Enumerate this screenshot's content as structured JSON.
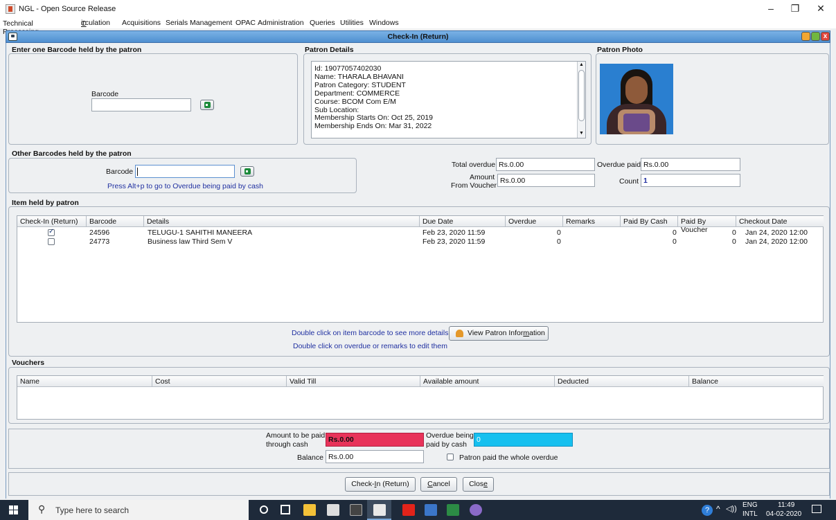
{
  "window": {
    "title": "NGL - Open Source Release",
    "min": "–",
    "max": "❐",
    "close": "✕"
  },
  "menu": [
    {
      "label": "Technical Processing",
      "mnemonic": ""
    },
    {
      "label": "Circulation",
      "mnemonic": "C"
    },
    {
      "label": "Acquisitions",
      "mnemonic": ""
    },
    {
      "label": "Serials Management",
      "mnemonic": ""
    },
    {
      "label": "OPAC",
      "mnemonic": ""
    },
    {
      "label": "Administration",
      "mnemonic": ""
    },
    {
      "label": "Queries",
      "mnemonic": ""
    },
    {
      "label": "Utilities",
      "mnemonic": ""
    },
    {
      "label": "Windows",
      "mnemonic": ""
    }
  ],
  "frame": {
    "title": "Check-In (Return)",
    "btn_colors": [
      "#f3a733",
      "#71b73f",
      "#e0453a"
    ]
  },
  "barcode_section": {
    "heading": "Enter one Barcode held by the patron",
    "label": "Barcode",
    "value": ""
  },
  "patron_details": {
    "heading": "Patron Details",
    "lines": [
      "Id: 19077057402030",
      "Name: THARALA BHAVANI",
      "Patron Category: STUDENT",
      "Department: COMMERCE",
      "Course: BCOM Com E/M",
      "Sub Location:",
      "Membership Starts On: Oct 25, 2019",
      "Membership Ends On: Mar 31, 2022"
    ]
  },
  "patron_photo": {
    "heading": "Patron Photo"
  },
  "other_barcodes": {
    "heading": "Other Barcodes held by the patron",
    "label": "Barcode",
    "value": "",
    "hint": "Press Alt+p to go to Overdue being paid by cash"
  },
  "summary": {
    "total_overdue_label": "Total overdue",
    "total_overdue": "Rs.0.00",
    "overdue_paid_label": "Overdue paid",
    "overdue_paid": "Rs.0.00",
    "amount_paid_label1": "Amount Paid",
    "amount_paid_label2": "From Voucher",
    "amount_paid": "Rs.0.00",
    "count_label": "Count",
    "count": "1"
  },
  "items": {
    "heading": "Item held by patron",
    "columns": [
      "Check-In (Return)",
      "Barcode",
      "Details",
      "Due Date",
      "Overdue",
      "Remarks",
      "Paid By Cash",
      "Paid By Voucher",
      "Checkout Date"
    ],
    "rows": [
      {
        "checked": true,
        "barcode": "24596",
        "details": "TELUGU-1 SAHITHI MANEERA",
        "due": "Feb 23, 2020 11:59",
        "overdue": "0",
        "remarks": "",
        "cash": "0",
        "voucher": "0",
        "checkout": "Jan 24, 2020 12:00"
      },
      {
        "checked": false,
        "barcode": "24773",
        "details": "Business law Third  Sem V",
        "due": "Feb 23, 2020 11:59",
        "overdue": "0",
        "remarks": "",
        "cash": "0",
        "voucher": "0",
        "checkout": "Jan 24, 2020 12:00"
      }
    ],
    "hint1": "Double click on item barcode to see more details",
    "hint2": "Double click on overdue or remarks to edit them",
    "view_btn": "View Patron Information"
  },
  "vouchers": {
    "heading": "Vouchers",
    "columns": [
      "Name",
      "Cost",
      "Valid Till",
      "Available amount",
      "Deducted",
      "Balance"
    ]
  },
  "payment": {
    "to_pay_label1": "Amount to be paid",
    "to_pay_label2": "through cash",
    "to_pay": "Rs.0.00",
    "to_pay_color": "#e8335a",
    "overdue_cash_label1": "Overdue being",
    "overdue_cash_label2": "paid by cash",
    "overdue_cash": "0",
    "overdue_cash_color": "#16c0ef",
    "balance_label": "Balance",
    "balance": "Rs.0.00",
    "whole_label": "Patron paid the whole overdue"
  },
  "buttons": {
    "checkin": "Check-In (Return)",
    "cancel": "Cancel",
    "close": "Close"
  },
  "taskbar": {
    "search_placeholder": "Type here to search",
    "lang1": "ENG",
    "lang2": "INTL",
    "time": "11:49",
    "date": "04-02-2020"
  }
}
